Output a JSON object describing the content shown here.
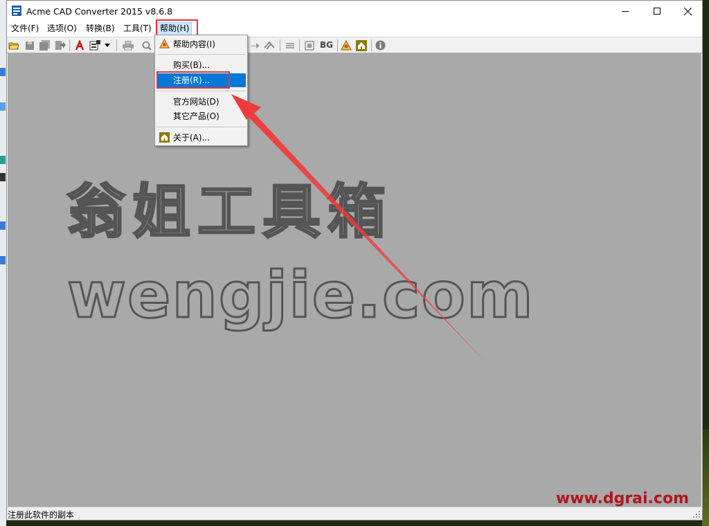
{
  "window": {
    "title": "Acme CAD Converter 2015 v8.6.8",
    "minimize_symbol": "—",
    "maximize_symbol": "☐",
    "close_symbol": "✕"
  },
  "menubar": {
    "items": [
      {
        "label": "文件(F)"
      },
      {
        "label": "选项(O)"
      },
      {
        "label": "转换(B)"
      },
      {
        "label": "工具(T)"
      },
      {
        "label": "帮助(H)"
      }
    ]
  },
  "help_menu": {
    "items": [
      {
        "label": "帮助内容(I)",
        "icon": "help-contents-icon"
      },
      {
        "label": "购买(B)..."
      },
      {
        "label": "注册(R)...",
        "selected": true
      },
      {
        "label": "官方网站(D)"
      },
      {
        "label": "其它产品(O)"
      },
      {
        "label": "关于(A)...",
        "icon": "home-icon"
      }
    ]
  },
  "toolbar": {
    "bg_label": "BG"
  },
  "canvas": {
    "background_color": "#a9a9a9",
    "watermark_cn": "翁姐工具箱",
    "watermark_en": "wengjie.com",
    "brand_watermark": "www.dgrai.com"
  },
  "status_bar": {
    "text": "注册此软件的副本"
  },
  "annotation": {
    "highlight_color": "#e8323a",
    "arrow_color": "#ef3b3b"
  }
}
